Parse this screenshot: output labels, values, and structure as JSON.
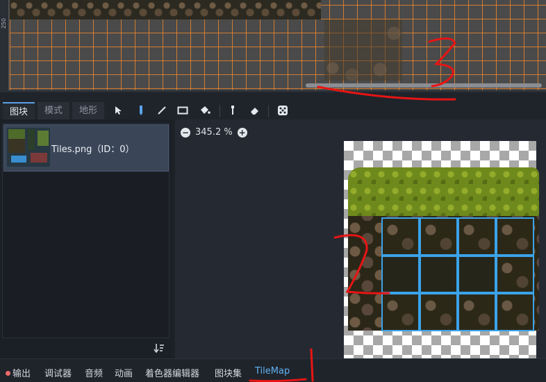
{
  "viewport": {
    "ruler_label": "250"
  },
  "toolbar": {
    "tabs": [
      {
        "label": "图块",
        "active": true
      },
      {
        "label": "模式",
        "active": false
      },
      {
        "label": "地形",
        "active": false
      }
    ],
    "tools": [
      "select-icon",
      "paint-icon",
      "line-icon",
      "rect-icon",
      "bucket-icon",
      "picker-icon",
      "eraser-icon",
      "random-icon"
    ]
  },
  "tileset_list": {
    "items": [
      {
        "label": "Tiles.png（ID：0）"
      }
    ]
  },
  "atlas": {
    "zoom": "345.2 %"
  },
  "bottom_tabs": [
    {
      "label": "输出",
      "active": false,
      "has_dot": true
    },
    {
      "label": "调试器",
      "active": false
    },
    {
      "label": "音频",
      "active": false
    },
    {
      "label": "动画",
      "active": false
    },
    {
      "label": "着色器编辑器",
      "active": false
    },
    {
      "label": "图块集",
      "active": false
    },
    {
      "label": "TileMap",
      "active": true
    }
  ],
  "annotations": [
    "1",
    "2",
    "3"
  ],
  "colors": {
    "accent": "#3ba3ea",
    "grid": "#ff8c28",
    "annotation": "#e81414"
  }
}
